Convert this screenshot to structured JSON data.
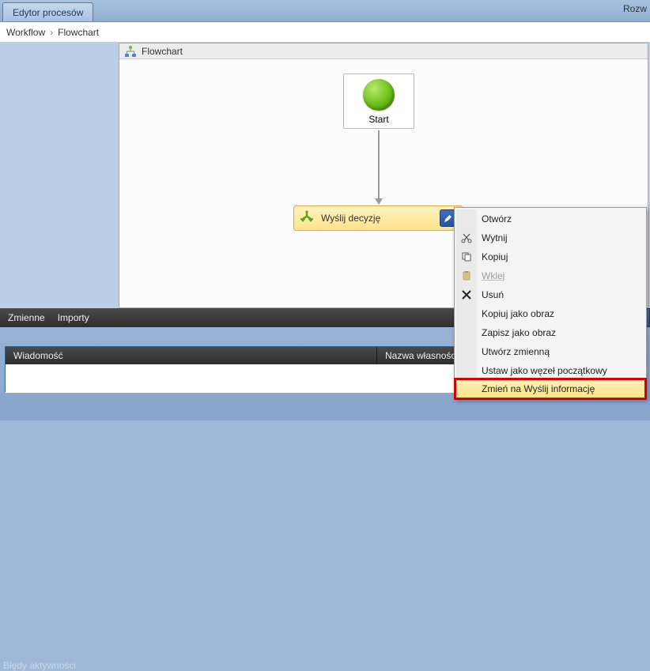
{
  "tab": {
    "title": "Edytor procesów"
  },
  "breadcrumb": {
    "root": "Workflow",
    "child": "Flowchart",
    "right": "Rozw"
  },
  "flowchart": {
    "header": "Flowchart",
    "start_label": "Start",
    "activity_label": "Wyślij decyzję"
  },
  "varbar": {
    "vars": "Zmienne",
    "imports": "Importy"
  },
  "errors": {
    "title": "Błędy aktywności",
    "col_message": "Wiadomość",
    "col_property": "Nazwa własności"
  },
  "context_menu": {
    "open": "Otwórz",
    "cut": "Wytnij",
    "copy": "Kopiuj",
    "paste": "Wklej",
    "delete": "Usuń",
    "copy_as_image": "Kopiuj jako obraz",
    "save_as_image": "Zapisz jako obraz",
    "create_var": "Utwórz zmienną",
    "set_start": "Ustaw jako węzeł początkowy",
    "change_to": "Zmień na Wyślij informację"
  }
}
